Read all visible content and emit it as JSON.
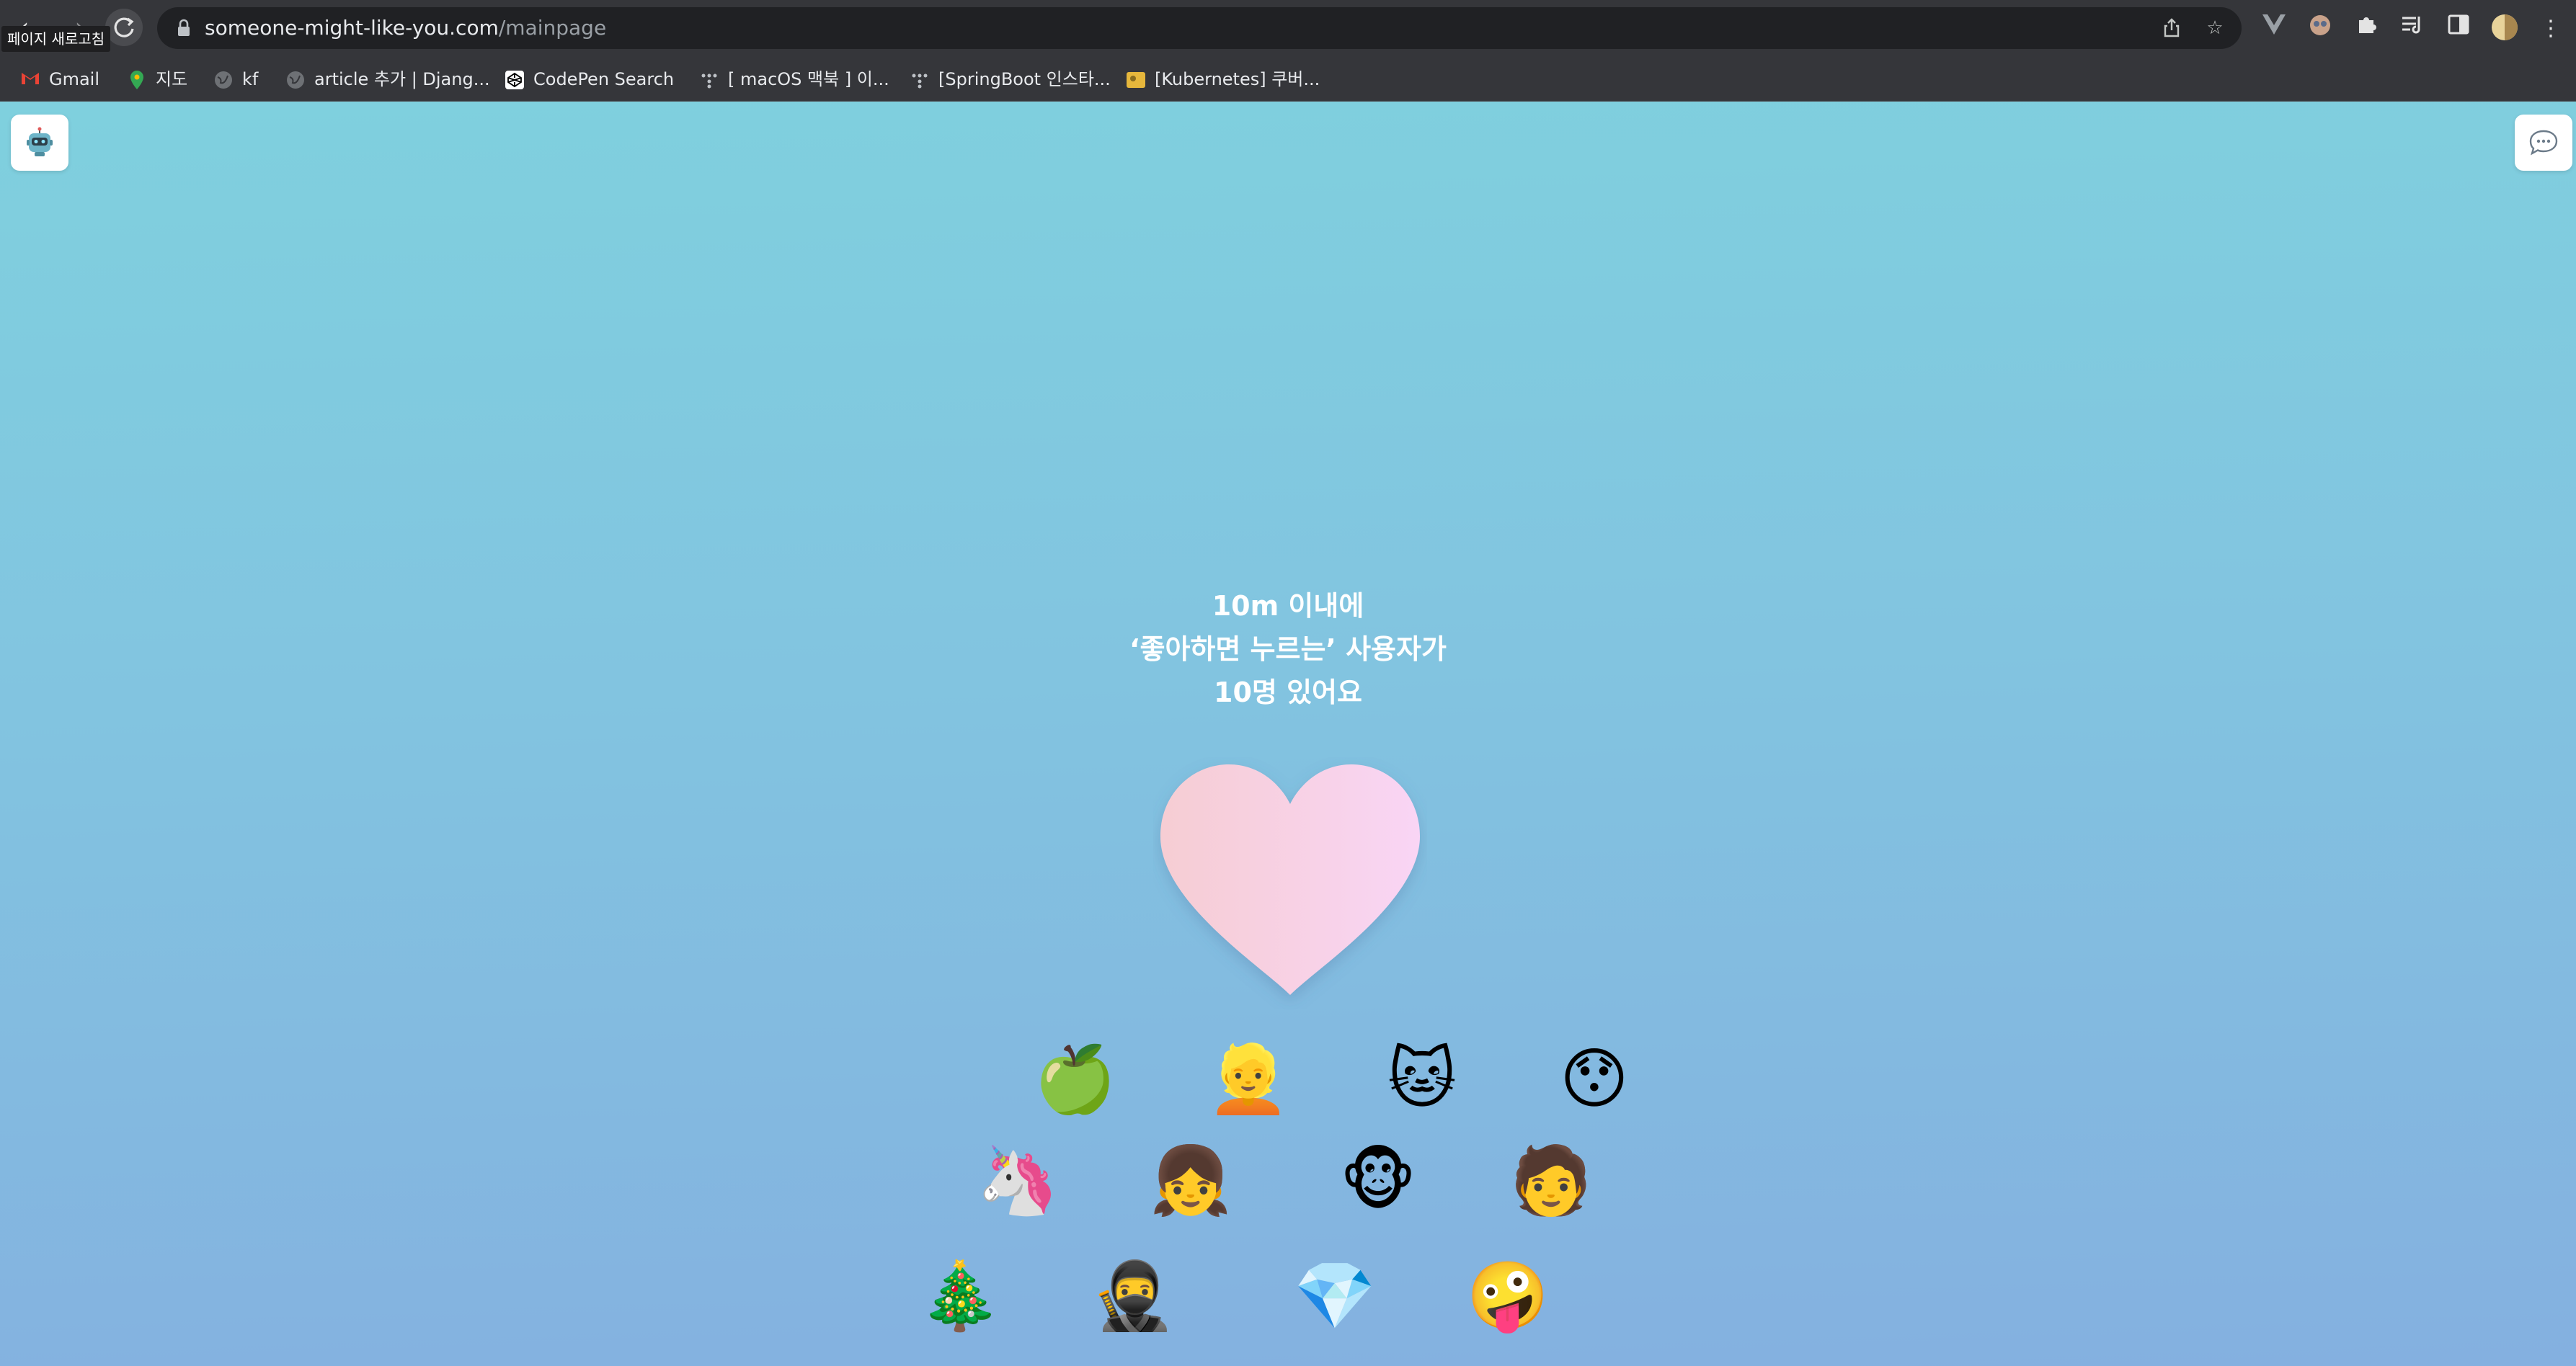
{
  "browser": {
    "tooltip": "페이지 새로고침",
    "nav_back_icon": "back-arrow-icon",
    "nav_forward_icon": "forward-arrow-icon",
    "reload_icon": "reload-icon",
    "url": {
      "host": "someone-might-like-you.com",
      "path": "/mainpage"
    },
    "bookmarks": [
      {
        "label": "Gmail",
        "icon": "gmail-icon"
      },
      {
        "label": "지도",
        "icon": "maps-pin-icon"
      },
      {
        "label": "kf",
        "icon": "globe-icon"
      },
      {
        "label": "article 추가 | Djang...",
        "icon": "globe-icon"
      },
      {
        "label": "CodePen Search",
        "icon": "codepen-icon"
      },
      {
        "label": "[ macOS 맥북 ] 이...",
        "icon": "dots-icon"
      },
      {
        "label": "[SpringBoot 인스타...",
        "icon": "dots-icon"
      },
      {
        "label": "[Kubernetes] 쿠버...",
        "icon": "folder-thumb-icon"
      }
    ]
  },
  "page": {
    "headline": {
      "line1": "10m 이내에",
      "line2": "‘좋아하면 누르는’ 사용자가",
      "line3": "10명 있어요"
    },
    "colors": {
      "heart_left": "#f6cdd3",
      "heart_right": "#f9d5f5",
      "bg_top": "#7fd0de",
      "bg_bottom": "#84b0e0"
    },
    "emojis": [
      {
        "name": "green-apple-icon",
        "glyph": "🍏"
      },
      {
        "name": "boruto-avatar-icon",
        "glyph": "👱"
      },
      {
        "name": "tom-cat-avatar-icon",
        "glyph": "🐱"
      },
      {
        "name": "surprised-face-icon",
        "glyph": "😯"
      },
      {
        "name": "unicorn-icon",
        "glyph": "🦄"
      },
      {
        "name": "paimon-avatar-icon",
        "glyph": "👧"
      },
      {
        "name": "cheburashka-avatar-icon",
        "glyph": "🐵"
      },
      {
        "name": "tanjiro-avatar-icon",
        "glyph": "🧑"
      },
      {
        "name": "christmas-tree-icon",
        "glyph": "🎄"
      },
      {
        "name": "itachi-avatar-icon",
        "glyph": "🥷"
      },
      {
        "name": "gem-icon",
        "glyph": "💎"
      },
      {
        "name": "zany-face-icon",
        "glyph": "🤪"
      }
    ]
  }
}
